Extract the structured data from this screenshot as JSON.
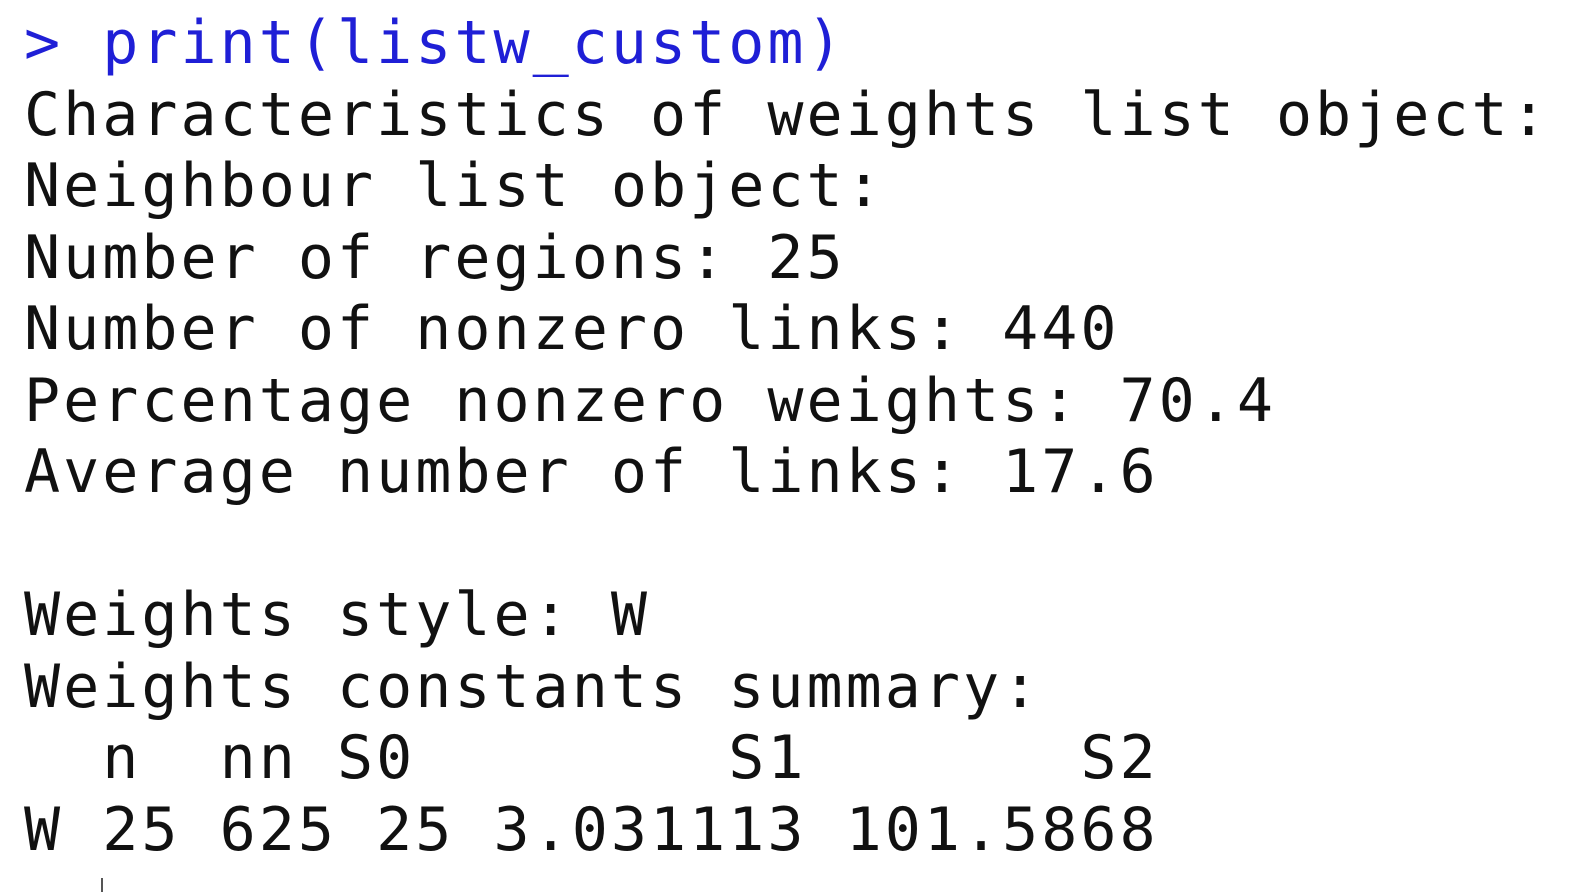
{
  "console": {
    "prompt": ">",
    "command": "print(listw_custom)",
    "lines": [
      "Characteristics of weights list object:",
      "Neighbour list object:",
      "Number of regions: 25",
      "Number of nonzero links: 440",
      "Percentage nonzero weights: 70.4",
      "Average number of links: 17.6"
    ],
    "style_line": "Weights style: W",
    "summary_title": "Weights constants summary:",
    "summary_header": "  n  nn S0        S1       S2",
    "summary_row": "W 25 625 25 3.031113 101.5868"
  }
}
